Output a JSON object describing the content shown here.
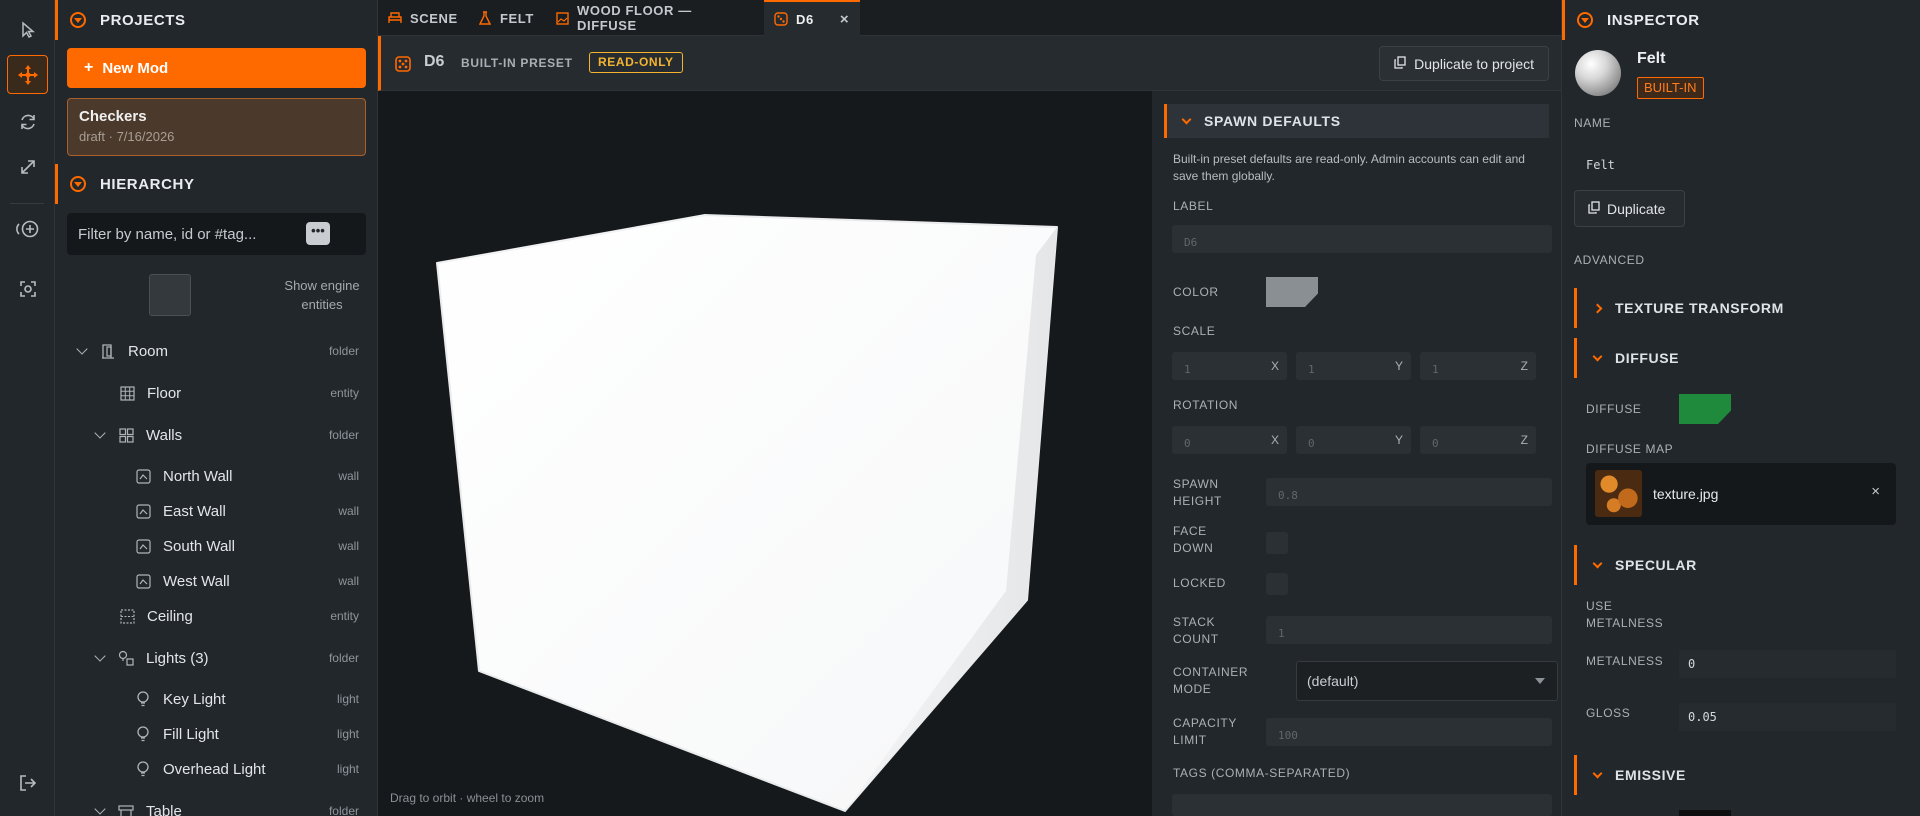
{
  "toolbar": {
    "tools": [
      "select-icon",
      "move-icon",
      "rotate-icon",
      "scale-icon",
      "add-spawn-icon",
      "focus-icon"
    ],
    "bottom": "logout-icon"
  },
  "projects": {
    "title": "PROJECTS",
    "new_button": "New Mod",
    "card_title": "Checkers",
    "card_sub": "draft · 7/16/2026"
  },
  "hierarchy": {
    "title": "HIERARCHY",
    "filter_placeholder": "Filter by name, id or #tag...",
    "filter_menu": "•••",
    "engine_label": "Show engine entities",
    "items": [
      {
        "label": "Room",
        "type": "folder"
      },
      {
        "label": "Floor",
        "type": "entity"
      },
      {
        "label": "Walls",
        "type": "folder"
      },
      {
        "label": "North Wall",
        "type": "wall"
      },
      {
        "label": "East Wall",
        "type": "wall"
      },
      {
        "label": "South Wall",
        "type": "wall"
      },
      {
        "label": "West Wall",
        "type": "wall"
      },
      {
        "label": "Ceiling",
        "type": "entity"
      },
      {
        "label": "Lights (3)",
        "type": "folder"
      },
      {
        "label": "Key Light",
        "type": "light"
      },
      {
        "label": "Fill Light",
        "type": "light"
      },
      {
        "label": "Overhead Light",
        "type": "light"
      },
      {
        "label": "Table",
        "type": "folder"
      }
    ]
  },
  "tabs": [
    {
      "label": "SCENE"
    },
    {
      "label": "FELT"
    },
    {
      "label": "WOOD FLOOR — DIFFUSE"
    },
    {
      "label": "D6",
      "close": "×"
    }
  ],
  "preset": {
    "name": "D6",
    "kind": "BUILT-IN PRESET",
    "badge": "READ-ONLY",
    "duplicate": "Duplicate to project"
  },
  "viewport": {
    "hint": "Drag to orbit · wheel to zoom"
  },
  "spawn": {
    "title": "SPAWN DEFAULTS",
    "note": "Built-in preset defaults are read-only. Admin accounts can edit and save them globally.",
    "label_label": "LABEL",
    "label_value": "D6",
    "color_label": "COLOR",
    "color": "#8a8f93",
    "scale_label": "SCALE",
    "scale": [
      "1",
      "1",
      "1"
    ],
    "rotation_label": "ROTATION",
    "rotation": [
      "0",
      "0",
      "0"
    ],
    "axes": [
      "X",
      "Y",
      "Z"
    ],
    "spawn_height_label": "SPAWN HEIGHT",
    "spawn_height": "0.8",
    "face_down_label": "FACE DOWN",
    "locked_label": "LOCKED",
    "stack_label": "STACK COUNT",
    "stack": "1",
    "container_label": "CONTAINER MODE",
    "container": "(default)",
    "capacity_label": "CAPACITY LIMIT",
    "capacity": "100",
    "tags_label": "TAGS (COMMA-SEPARATED)"
  },
  "inspector": {
    "title": "INSPECTOR",
    "material": "Felt",
    "badge": "BUILT-IN",
    "name_label": "NAME",
    "name_value": "Felt",
    "duplicate": "Duplicate",
    "advanced": "ADVANCED",
    "texture_transform": "TEXTURE TRANSFORM",
    "diffuse": "DIFFUSE",
    "diffuse_label": "DIFFUSE",
    "diffuse_color": "#1f8a3c",
    "diffuse_map_label": "DIFFUSE MAP",
    "diffuse_map": "texture.jpg",
    "diffuse_map_close": "×",
    "specular": "SPECULAR",
    "use_metalness": "USE METALNESS",
    "metalness_label": "METALNESS",
    "metalness": "0",
    "gloss_label": "GLOSS",
    "gloss": "0.05",
    "emissive": "EMISSIVE"
  }
}
